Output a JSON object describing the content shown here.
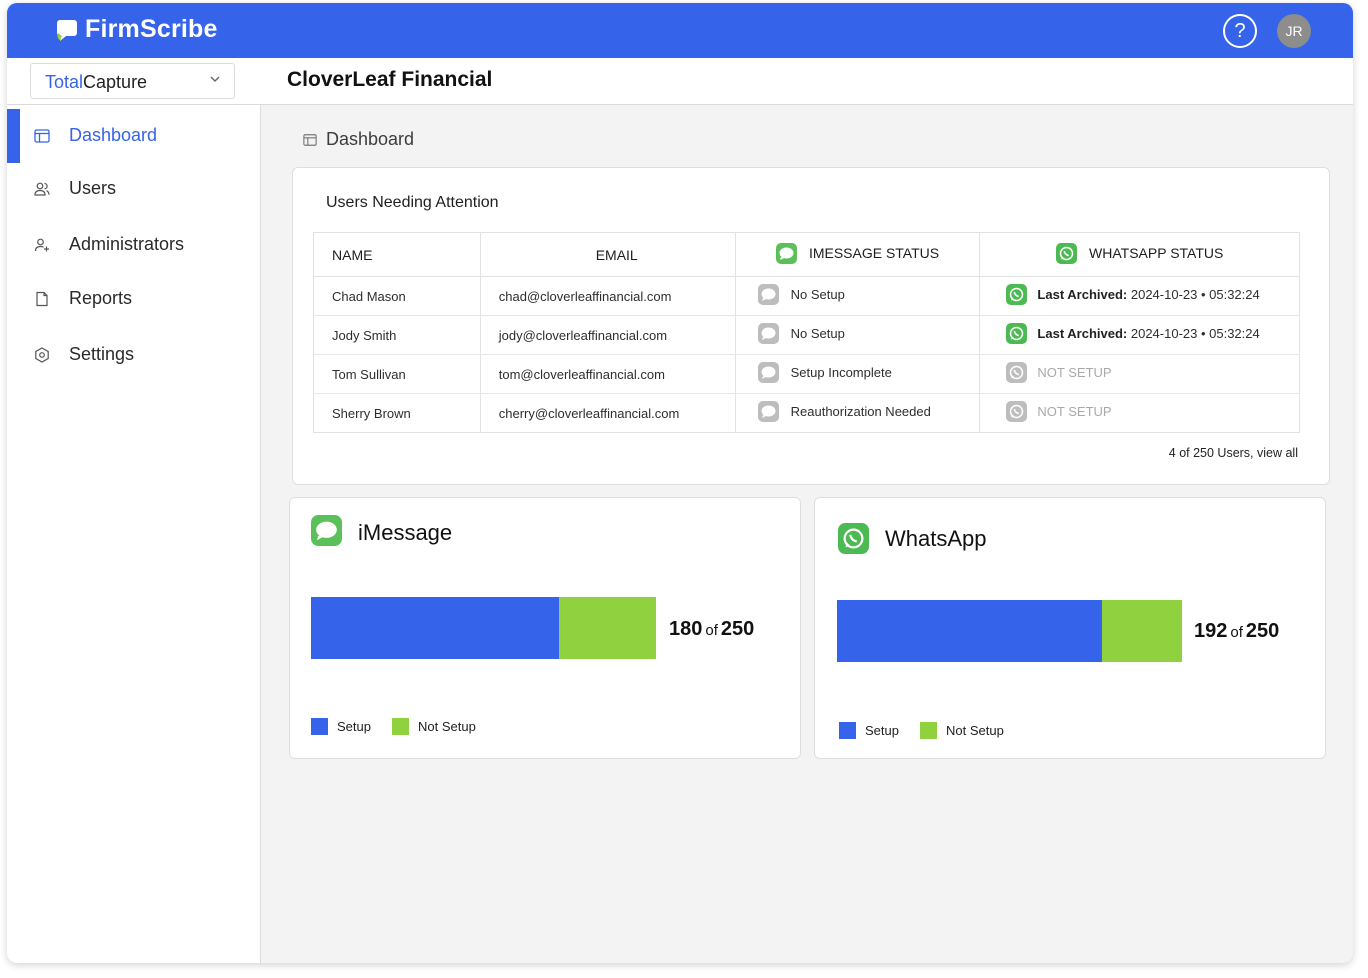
{
  "app": {
    "brand": "FirmScribe",
    "help_icon": "help-icon",
    "avatar_initials": "JR"
  },
  "header": {
    "product_prefix": "Total",
    "product_suffix": "Capture",
    "org_name": "CloverLeaf Financial"
  },
  "sidebar": {
    "items": [
      {
        "label": "Dashboard",
        "icon": "dashboard-icon",
        "active": true
      },
      {
        "label": "Users",
        "icon": "users-icon"
      },
      {
        "label": "Administrators",
        "icon": "admin-icon"
      },
      {
        "label": "Reports",
        "icon": "document-icon"
      },
      {
        "label": "Settings",
        "icon": "gear-icon"
      }
    ]
  },
  "breadcrumb": {
    "label": "Dashboard"
  },
  "attention": {
    "title": "Users Needing Attention",
    "columns": [
      "NAME",
      "EMAIL",
      "IMESSAGE STATUS",
      "WHATSAPP STATUS"
    ],
    "rows": [
      {
        "name": "Chad Mason",
        "email": "chad@cloverleaffinancial.com",
        "imessage": "No Setup",
        "wa_label": "Last Archived:",
        "wa_value": " 2024-10-23 • 05:32:24",
        "wa_setup": true
      },
      {
        "name": "Jody Smith",
        "email": "jody@cloverleaffinancial.com",
        "imessage": "No Setup",
        "wa_label": "Last Archived:",
        "wa_value": " 2024-10-23 • 05:32:24",
        "wa_setup": true
      },
      {
        "name": "Tom Sullivan",
        "email": "tom@cloverleaffinancial.com",
        "imessage": "Setup Incomplete",
        "wa_label": "",
        "wa_value": "NOT SETUP",
        "wa_setup": false
      },
      {
        "name": "Sherry Brown",
        "email": "cherry@cloverleaffinancial.com",
        "imessage": "Reauthorization Needed",
        "wa_label": "",
        "wa_value": "NOT SETUP",
        "wa_setup": false
      }
    ],
    "footer": "4 of 250 Users, view all"
  },
  "imessage": {
    "title": "iMessage",
    "setup": 180,
    "total": 250,
    "of": "of",
    "legend_setup": "Setup",
    "legend_not_setup": "Not Setup"
  },
  "whatsapp": {
    "title": "WhatsApp",
    "setup": 192,
    "total": 250,
    "of": "of",
    "legend_setup": "Setup",
    "legend_not_setup": "Not Setup"
  },
  "colors": {
    "accent": "#3563e9",
    "setup": "#3563e9",
    "not_setup": "#8fd13f",
    "imessage_green": "#5cc05a",
    "whatsapp_green": "#4cba52",
    "gray_icon": "#bdbdbd"
  }
}
